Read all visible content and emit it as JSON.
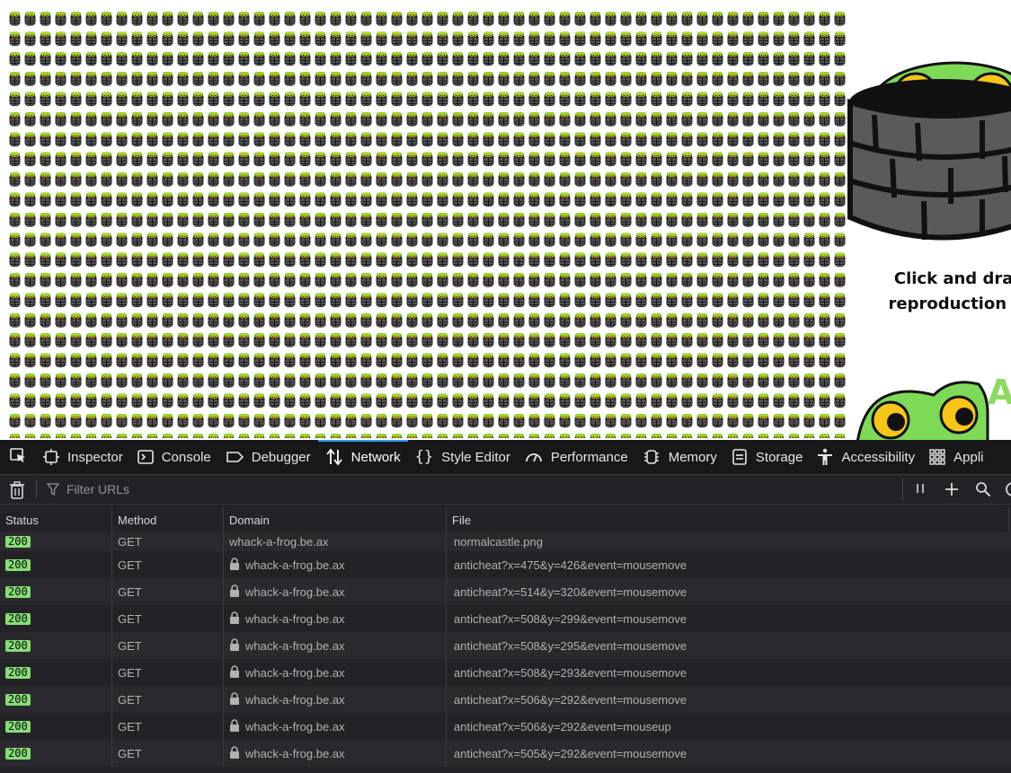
{
  "devtools": {
    "tabs": [
      {
        "label": "Inspector",
        "icon": "inspector-icon"
      },
      {
        "label": "Console",
        "icon": "console-icon"
      },
      {
        "label": "Debugger",
        "icon": "debugger-icon"
      },
      {
        "label": "Network",
        "icon": "network-icon",
        "selected": true
      },
      {
        "label": "Style Editor",
        "icon": "style-editor-icon"
      },
      {
        "label": "Performance",
        "icon": "performance-icon"
      },
      {
        "label": "Memory",
        "icon": "memory-icon"
      },
      {
        "label": "Storage",
        "icon": "storage-icon"
      },
      {
        "label": "Accessibility",
        "icon": "accessibility-icon"
      },
      {
        "label": "Appli",
        "icon": "application-icon"
      }
    ],
    "toolbar": {
      "filter_placeholder": "Filter URLs"
    },
    "network": {
      "columns": {
        "status": "Status",
        "method": "Method",
        "domain": "Domain",
        "file": "File"
      },
      "rows": [
        {
          "status": "200",
          "method": "GET",
          "domain": "whack-a-frog.be.ax",
          "file": "normalcastle.png",
          "secure": false
        },
        {
          "status": "200",
          "method": "GET",
          "domain": "whack-a-frog.be.ax",
          "file": "anticheat?x=475&y=426&event=mousemove",
          "secure": true
        },
        {
          "status": "200",
          "method": "GET",
          "domain": "whack-a-frog.be.ax",
          "file": "anticheat?x=514&y=320&event=mousemove",
          "secure": true
        },
        {
          "status": "200",
          "method": "GET",
          "domain": "whack-a-frog.be.ax",
          "file": "anticheat?x=508&y=299&event=mousemove",
          "secure": true
        },
        {
          "status": "200",
          "method": "GET",
          "domain": "whack-a-frog.be.ax",
          "file": "anticheat?x=508&y=295&event=mousemove",
          "secure": true
        },
        {
          "status": "200",
          "method": "GET",
          "domain": "whack-a-frog.be.ax",
          "file": "anticheat?x=508&y=293&event=mousemove",
          "secure": true
        },
        {
          "status": "200",
          "method": "GET",
          "domain": "whack-a-frog.be.ax",
          "file": "anticheat?x=506&y=292&event=mousemove",
          "secure": true
        },
        {
          "status": "200",
          "method": "GET",
          "domain": "whack-a-frog.be.ax",
          "file": "anticheat?x=506&y=292&event=mouseup",
          "secure": true
        },
        {
          "status": "200",
          "method": "GET",
          "domain": "whack-a-frog.be.ax",
          "file": "anticheat?x=505&y=292&event=mousemove",
          "secure": true
        }
      ]
    },
    "colors": {
      "accent": "#2a9bff",
      "status_ok": "#86de74",
      "background": "#232327"
    }
  },
  "game": {
    "instructions_line1": "Click and drag t",
    "instructions_line2": "reproduction of m",
    "banner_fragment": "Ap",
    "colors": {
      "frog": "#7ed957",
      "castle": "#555555"
    }
  }
}
